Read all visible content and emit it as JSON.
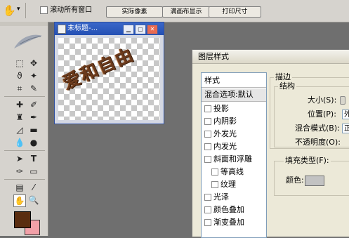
{
  "options_bar": {
    "scroll_all_label": "滚动所有窗口",
    "actual_pixels_label": "实际像素",
    "fit_screen_label": "满画布显示",
    "print_size_label": "打印尺寸"
  },
  "document": {
    "title": "未标题-...",
    "canvas_text": "爱和自由",
    "text_color": "#6b3a1c"
  },
  "toolbox": {
    "foreground_color": "#5a2d10",
    "background_color": "#f2a0a8"
  },
  "dialog": {
    "title": "图层样式",
    "styles_header": "样式",
    "blend_options": "混合选项:默认",
    "effects": [
      "投影",
      "内阴影",
      "外发光",
      "内发光",
      "斜面和浮雕",
      "等高线",
      "纹理",
      "光泽",
      "颜色叠加",
      "渐变叠加"
    ],
    "stroke": {
      "section_title": "描边",
      "structure_title": "结构",
      "size_label": "大小(S):",
      "position_label": "位置(P):",
      "position_value": "外",
      "blend_mode_label": "混合模式(B):",
      "blend_mode_value": "正",
      "opacity_label": "不透明度(O):",
      "fill_type_label": "填充类型(F):",
      "color_label": "颜色:",
      "swatch_color": "#c2c2c2"
    }
  }
}
